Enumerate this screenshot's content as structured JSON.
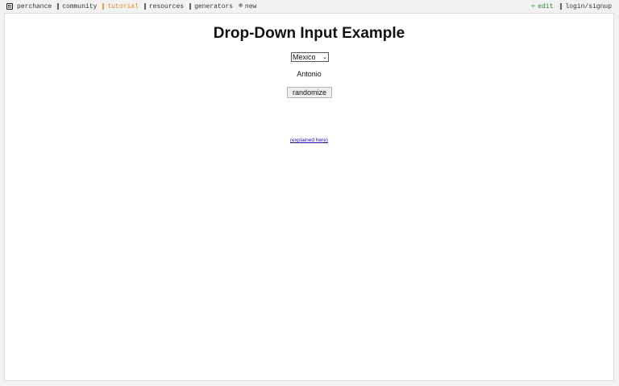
{
  "nav": {
    "left": [
      {
        "label": "perchance",
        "icon": "die-icon"
      },
      {
        "label": "community",
        "icon": "community-icon"
      },
      {
        "label": "tutorial",
        "icon": "tutorial-icon"
      },
      {
        "label": "resources",
        "icon": "resources-icon"
      },
      {
        "label": "generators",
        "icon": "generators-icon"
      },
      {
        "label": "new",
        "icon": "plus-circle-icon"
      }
    ],
    "right": [
      {
        "label": "edit",
        "icon": "pencil-icon"
      },
      {
        "label": "login/signup",
        "icon": "user-icon"
      }
    ],
    "colors": {
      "active": "#e08a1e",
      "edit": "#2a8a2a"
    }
  },
  "main": {
    "title": "Drop-Down Input Example",
    "select": {
      "selected": "Mexico"
    },
    "result": "Antonio",
    "randomize_label": "randomize",
    "explained_link": "(explained here)"
  }
}
